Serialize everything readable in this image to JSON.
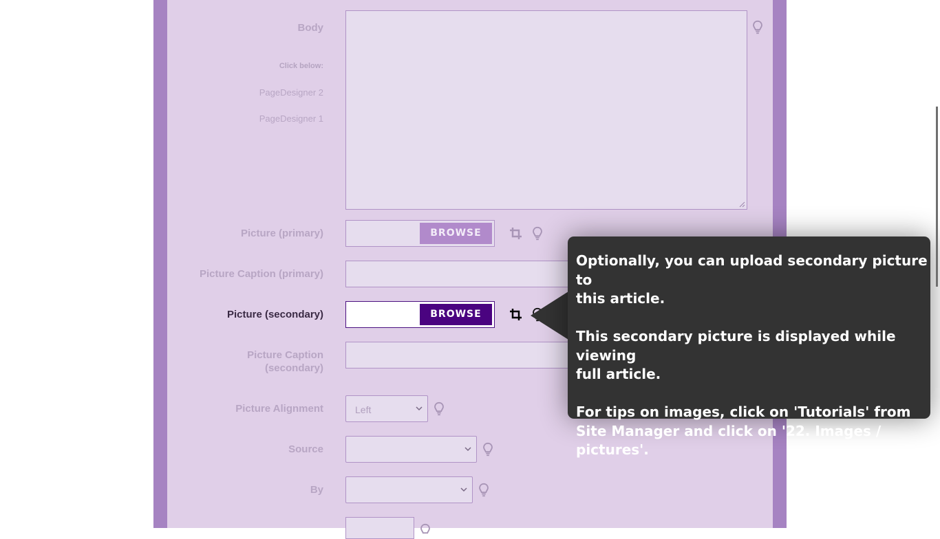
{
  "form": {
    "body_label": "Body",
    "click_below": "Click below:",
    "page_designer_2": "PageDesigner 2",
    "page_designer_1": "PageDesigner 1",
    "picture_primary_label": "Picture (primary)",
    "picture_caption_primary_label": "Picture Caption (primary)",
    "picture_secondary_label": "Picture (secondary)",
    "picture_caption_secondary_line1": "Picture Caption",
    "picture_caption_secondary_line2": "(secondary)",
    "picture_alignment_label": "Picture Alignment",
    "picture_alignment_value": "Left",
    "source_label": "Source",
    "source_value": "",
    "by_label": "By",
    "by_value": "",
    "browse_label": "BROWSE"
  },
  "tooltip": {
    "para1": "Optionally, you can upload secondary picture to\nthis article.",
    "para2": "This secondary picture is displayed while viewing\nfull article.",
    "para3": "For tips on images, click on 'Tutorials' from\nSite Manager and click on '22. Images / pictures'."
  },
  "colors": {
    "panel_bg": "#e0cfe8",
    "frame_accent": "#a683c2",
    "browse_active": "#4a0380",
    "browse_inactive": "#b18acb",
    "tooltip_bg": "#333333"
  }
}
